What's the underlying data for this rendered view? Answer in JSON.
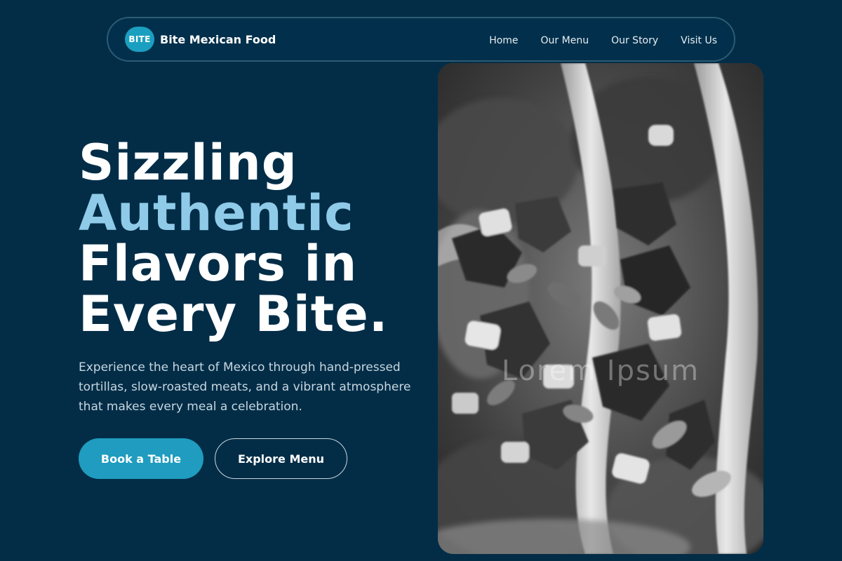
{
  "brand": {
    "badge": "BITE",
    "name": "Bite Mexican Food"
  },
  "nav": {
    "items": [
      {
        "label": "Home"
      },
      {
        "label": "Our Menu"
      },
      {
        "label": "Our Story"
      },
      {
        "label": "Visit Us"
      }
    ]
  },
  "hero": {
    "title_line1": "Sizzling",
    "title_accent": "Authentic",
    "title_line3": "Flavors in",
    "title_line4": "Every Bite.",
    "description": "Experience the heart of Mexico through hand-pressed tortillas, slow-roasted meats, and a vibrant atmosphere that makes every meal a celebration.",
    "primary_button": "Book a Table",
    "secondary_button": "Explore Menu"
  },
  "image": {
    "subject": "tacos-photo",
    "watermark": "Lorem Ipsum"
  },
  "colors": {
    "background": "#032d47",
    "accent_text": "#8fcbe8",
    "primary_button": "#1f9cbf",
    "brand_badge": "#1b9fc0"
  }
}
